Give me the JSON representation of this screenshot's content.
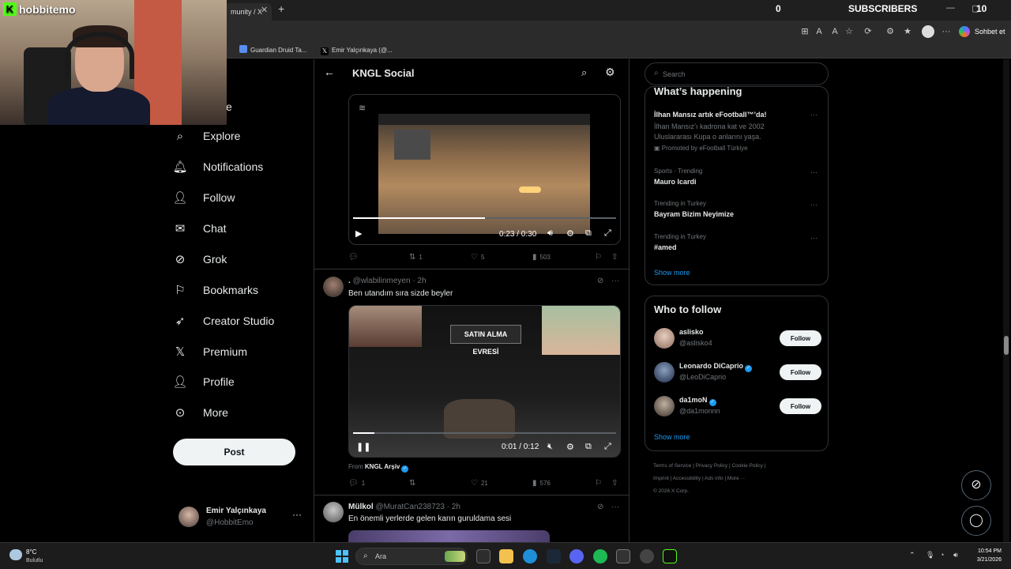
{
  "stream_overlay": {
    "brand": "hobbitemo",
    "subscribers_count": "0",
    "subscribers_label": "SUBSCRIBERS",
    "right_value": "10"
  },
  "browser": {
    "tab_title": "munity / X",
    "favorites": [
      "Guardian Druid Ta...",
      "Emir Yalçınkaya (@..."
    ],
    "copilot_label": "Sohbet et"
  },
  "nav": {
    "partial_label": "e",
    "items": [
      {
        "label": "Explore",
        "icon": "search-icon"
      },
      {
        "label": "Notifications",
        "icon": "bell-icon"
      },
      {
        "label": "Follow",
        "icon": "person-add-icon"
      },
      {
        "label": "Chat",
        "icon": "envelope-icon"
      },
      {
        "label": "Grok",
        "icon": "grok-icon"
      },
      {
        "label": "Bookmarks",
        "icon": "bookmark-icon"
      },
      {
        "label": "Creator Studio",
        "icon": "rocket-icon"
      },
      {
        "label": "Premium",
        "icon": "x-logo-icon"
      },
      {
        "label": "Profile",
        "icon": "person-icon"
      },
      {
        "label": "More",
        "icon": "more-circle-icon"
      }
    ],
    "post_label": "Post",
    "account": {
      "name": "Emir Yalçınkaya",
      "handle": "@HobbitEmo",
      "menu": "···"
    }
  },
  "feed": {
    "title": "KNGL Social",
    "video1": {
      "time": "0:23 / 0:30",
      "progress": 0.5
    },
    "tweet1_actions": {
      "replies": "",
      "reposts": "1",
      "likes": "5",
      "views": "503"
    },
    "tweet2": {
      "name": ".",
      "handle": "@wlabilinmeyen",
      "time": "· 2h",
      "text": "Ben utandım sıra sizde beyler",
      "overlay_text": "SATIN ALMA EVRESİ",
      "video_time": "0:01 / 0:12",
      "progress": 0.08,
      "from_prefix": "From",
      "from_name": "KNGL Arşiv",
      "actions": {
        "replies": "1",
        "reposts": "",
        "likes": "21",
        "views": "576"
      }
    },
    "tweet3": {
      "name": "Mülkol",
      "handle": "@MuratCan238723",
      "time": "· 2h",
      "text": "En önemli yerlerde gelen karın guruldama sesi"
    }
  },
  "right": {
    "search_placeholder": "Search",
    "happening_title": "What’s happening",
    "trends": [
      {
        "meta": "",
        "name": "İlhan Mansız artık eFootball™’da!",
        "desc": "İlhan Mansız’ı kadrona kat ve 2002 Uluslararası Kupa o anlarını yaşa.",
        "promo": "Promoted by eFootball Türkiye"
      },
      {
        "meta": "Sports · Trending",
        "name": "Mauro Icardi"
      },
      {
        "meta": "Trending in Turkey",
        "name": "Bayram Bizim Neyimize"
      },
      {
        "meta": "Trending in Turkey",
        "name": "#amed"
      }
    ],
    "show_more": "Show more",
    "wtf_title": "Who to follow",
    "who_to_follow": [
      {
        "name": "aslisko",
        "handle": "@aslisko4",
        "verified": false
      },
      {
        "name": "Leonardo DiCaprio",
        "handle": "@LeoDiCaprio",
        "verified": true
      },
      {
        "name": "da1moN",
        "handle": "@da1monnn",
        "verified": true
      }
    ],
    "follow_label": "Follow",
    "footer_line1": "Terms of Service  |  Privacy Policy  |  Cookie Policy  |",
    "footer_line2": "Imprint  |  Accessibility  |  Ads info  |  More ···",
    "footer_line3": "© 2026 X Corp."
  },
  "taskbar": {
    "temp": "8°C",
    "weather": "Bulutlu",
    "search_label": "Ara",
    "time": "10:54 PM",
    "date": "3/21/2026"
  }
}
